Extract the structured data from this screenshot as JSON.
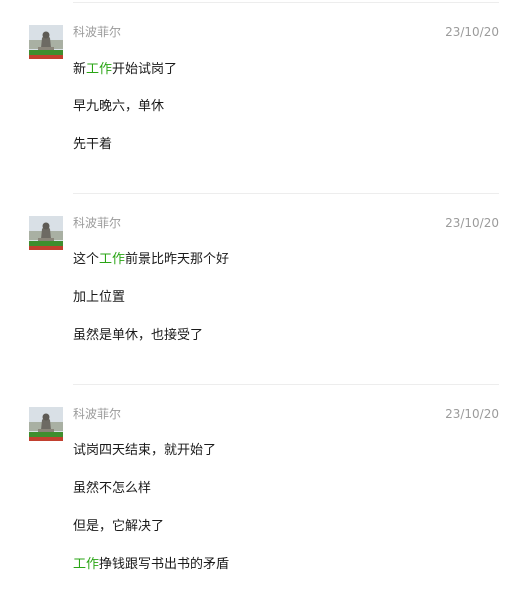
{
  "posts": [
    {
      "author": "科波菲尔",
      "date": "23/10/20",
      "avatar_icon": "statue-avatar-icon",
      "lines": [
        {
          "before": "新",
          "highlight": "工作",
          "after": "开始试岗了"
        },
        {
          "before": "早九晚六，单休",
          "highlight": "",
          "after": ""
        },
        {
          "before": "先干着",
          "highlight": "",
          "after": ""
        }
      ]
    },
    {
      "author": "科波菲尔",
      "date": "23/10/20",
      "avatar_icon": "statue-avatar-icon",
      "lines": [
        {
          "before": "这个",
          "highlight": "工作",
          "after": "前景比昨天那个好"
        },
        {
          "before": "加上位置",
          "highlight": "",
          "after": ""
        },
        {
          "before": "虽然是单休，也接受了",
          "highlight": "",
          "after": ""
        }
      ]
    },
    {
      "author": "科波菲尔",
      "date": "23/10/20",
      "avatar_icon": "statue-avatar-icon",
      "lines": [
        {
          "before": "试岗四天结束，就开始了",
          "highlight": "",
          "after": ""
        },
        {
          "before": "虽然不怎么样",
          "highlight": "",
          "after": ""
        },
        {
          "before": "但是，它解决了",
          "highlight": "",
          "after": ""
        },
        {
          "before": "",
          "highlight": "工作",
          "after": "挣钱跟写书出书的矛盾"
        }
      ]
    }
  ],
  "colors": {
    "highlight": "#2aa515",
    "meta_text": "#9b9b9b",
    "body_text": "#1a1a1a",
    "divider": "#ededed"
  }
}
